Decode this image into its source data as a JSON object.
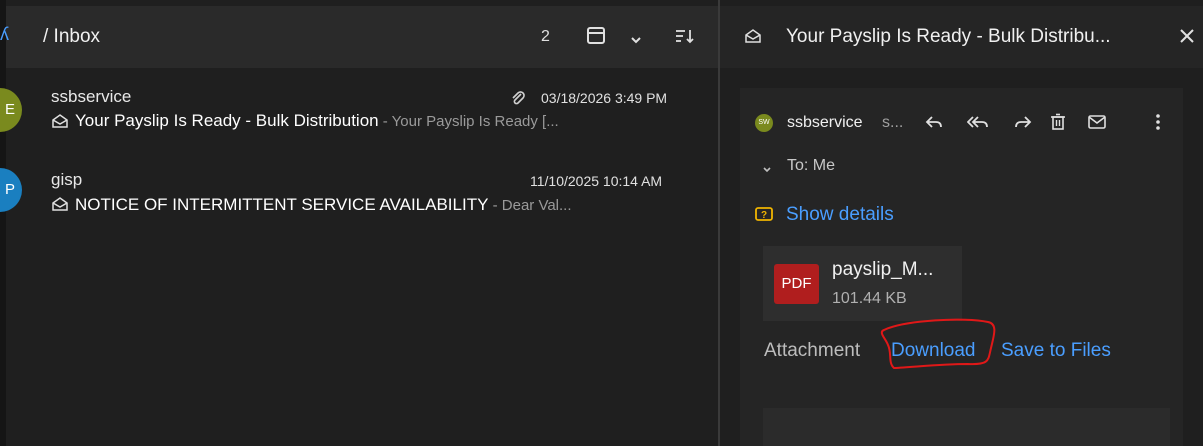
{
  "left_header": {
    "title": "/ Inbox",
    "count": "2",
    "icons": [
      "layout-icon",
      "chevron-down-icon",
      "sort-icon"
    ]
  },
  "messages": [
    {
      "avatar_letter": "E",
      "avatar_color": "#7a8a1e",
      "sender": "ssbservice",
      "date": "03/18/2026 3:49 PM",
      "has_attachment": true,
      "subject": "Your Payslip Is Ready - Bulk Distribution",
      "preview": " - Your Payslip Is Ready [..."
    },
    {
      "avatar_letter": "P",
      "avatar_color": "#1a7fc0",
      "sender": "gisp",
      "date": "11/10/2025 10:14 AM",
      "has_attachment": false,
      "subject": "NOTICE OF INTERMITTENT SERVICE AVAILABILITY",
      "preview": " - Dear Val..."
    }
  ],
  "reader": {
    "title": "Your Payslip Is Ready - Bulk Distribu...",
    "sender_initials": "SW",
    "sender_name": "ssbservice",
    "sender_email_trunc": "s...",
    "to_label": "To: Me",
    "show_details": "Show details",
    "attachment": {
      "type_label": "PDF",
      "name": "payslip_M...",
      "size": "101.44 KB"
    },
    "attachment_label": "Attachment",
    "download_label": "Download",
    "save_label": "Save to Files"
  },
  "colors": {
    "accent_link": "#4a9eff",
    "pdf_red": "#b01e1e",
    "annotation_red": "#e01818"
  }
}
